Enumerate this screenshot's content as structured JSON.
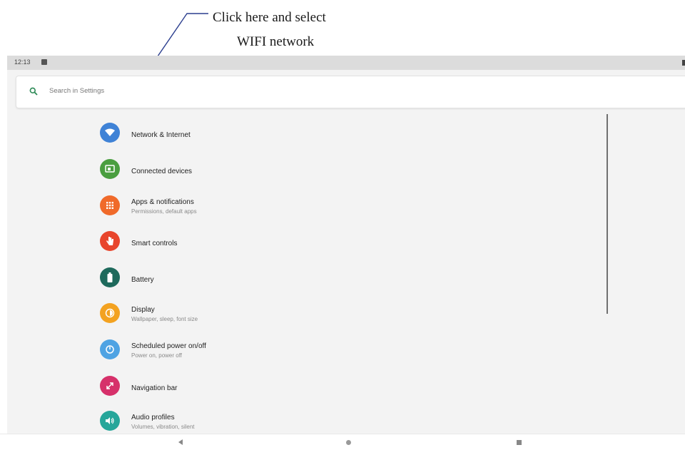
{
  "annotation": {
    "line1": "Click here and select",
    "line2": "WIFI network"
  },
  "statusbar": {
    "time": "12:13"
  },
  "search": {
    "placeholder": "Search in Settings"
  },
  "items": [
    {
      "title": "Network & Internet",
      "subtitle": "",
      "color": "#3f82d6",
      "icon": "wifi-icon"
    },
    {
      "title": "Connected devices",
      "subtitle": "",
      "color": "#4a9e3f",
      "icon": "devices-icon"
    },
    {
      "title": "Apps & notifications",
      "subtitle": "Permissions, default apps",
      "color": "#f06a2a",
      "icon": "apps-grid-icon"
    },
    {
      "title": "Smart controls",
      "subtitle": "",
      "color": "#e8452c",
      "icon": "hand-icon"
    },
    {
      "title": "Battery",
      "subtitle": "",
      "color": "#1e6a5c",
      "icon": "battery-icon"
    },
    {
      "title": "Display",
      "subtitle": "Wallpaper, sleep, font size",
      "color": "#f3a220",
      "icon": "brightness-icon"
    },
    {
      "title": "Scheduled power on/off",
      "subtitle": "Power on, power off",
      "color": "#4fa3e3",
      "icon": "power-icon"
    },
    {
      "title": "Navigation bar",
      "subtitle": "",
      "color": "#d6306a",
      "icon": "navigation-icon"
    },
    {
      "title": "Audio profiles",
      "subtitle": "Volumes, vibration, silent",
      "color": "#26a69a",
      "icon": "speaker-icon"
    }
  ]
}
